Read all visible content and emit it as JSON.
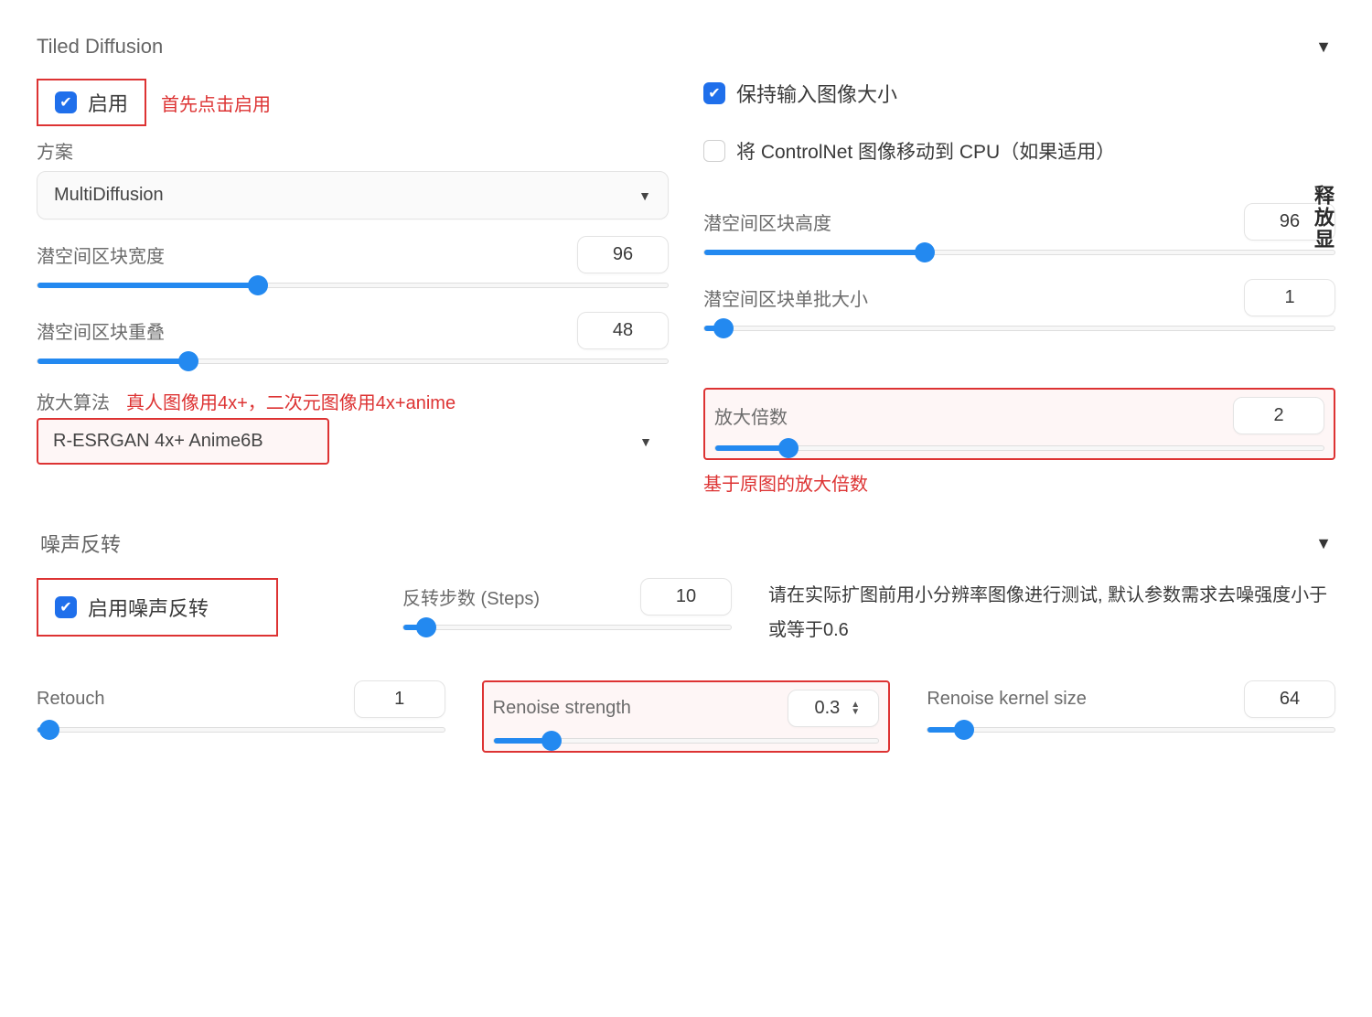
{
  "section1": {
    "title": "Tiled Diffusion",
    "enable_label": "启用",
    "enable_annot": "首先点击启用",
    "keep_input_label": "保持输入图像大小",
    "controlnet_label": "将 ControlNet 图像移动到 CPU（如果适用）",
    "vertical_btn": "释放显",
    "scheme_label": "方案",
    "scheme_value": "MultiDiffusion",
    "tile_width_label": "潜空间区块宽度",
    "tile_width_value": "96",
    "tile_height_label": "潜空间区块高度",
    "tile_height_value": "96",
    "tile_overlap_label": "潜空间区块重叠",
    "tile_overlap_value": "48",
    "tile_batch_label": "潜空间区块单批大小",
    "tile_batch_value": "1",
    "upscale_algo_label": "放大算法",
    "upscale_algo_value": "R-ESRGAN 4x+ Anime6B",
    "upscale_algo_annot": "真人图像用4x+，二次元图像用4x+anime",
    "upscale_factor_label": "放大倍数",
    "upscale_factor_value": "2",
    "upscale_factor_annot": "基于原图的放大倍数"
  },
  "section2": {
    "title": "噪声反转",
    "enable_label": "启用噪声反转",
    "steps_label": "反转步数 (Steps)",
    "steps_value": "10",
    "help_text": "请在实际扩图前用小分辨率图像进行测试, 默认参数需求去噪强度小于或等于0.6",
    "retouch_label": "Retouch",
    "retouch_value": "1",
    "renoise_strength_label": "Renoise strength",
    "renoise_strength_value": "0.3",
    "renoise_kernel_label": "Renoise kernel size",
    "renoise_kernel_value": "64"
  }
}
